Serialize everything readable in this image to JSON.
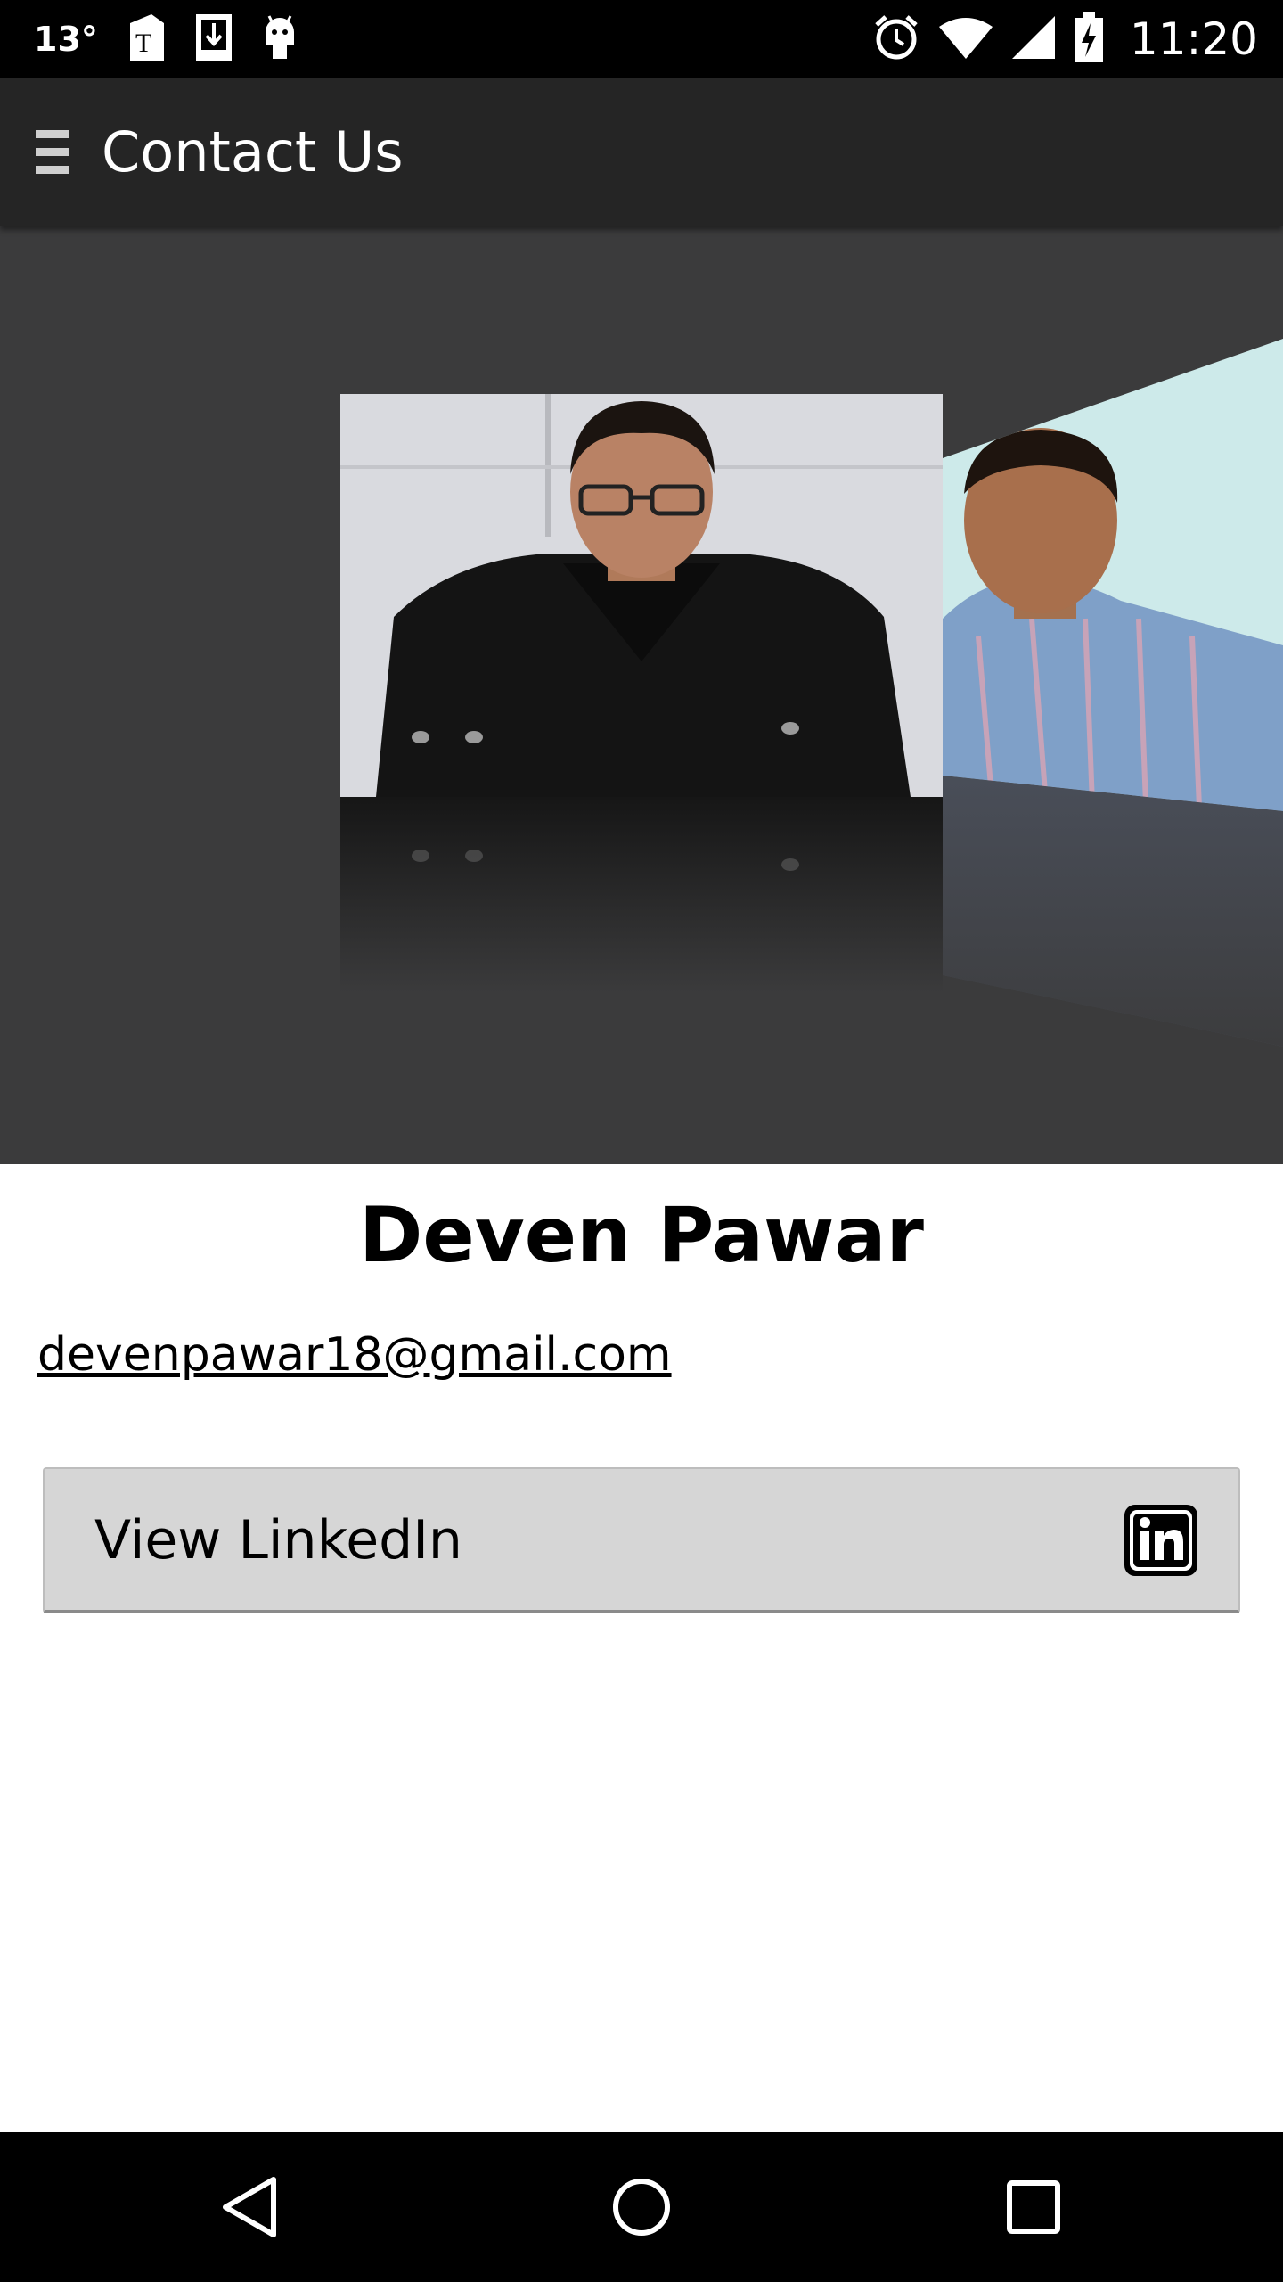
{
  "status_bar": {
    "temperature": "13°",
    "time": "11:20",
    "icons": [
      "t-mobile-icon",
      "download-icon",
      "android-icon",
      "alarm-icon",
      "wifi-icon",
      "signal-icon",
      "battery-icon"
    ]
  },
  "app_bar": {
    "title": "Contact Us",
    "menu_icon": "hamburger-menu-icon"
  },
  "profile": {
    "name": "Deven Pawar",
    "email": "devenpawar18@gmail.com"
  },
  "linkedin_button": {
    "label": "View LinkedIn",
    "icon": "linkedin-icon"
  },
  "navigation": {
    "buttons": [
      "back-icon",
      "home-icon",
      "recents-icon"
    ]
  },
  "colors": {
    "status_bar": "#000000",
    "app_bar": "#252525",
    "hero_bg": "#3b3b3c",
    "button_bg": "#d6d6d6",
    "content_bg": "#ffffff"
  }
}
